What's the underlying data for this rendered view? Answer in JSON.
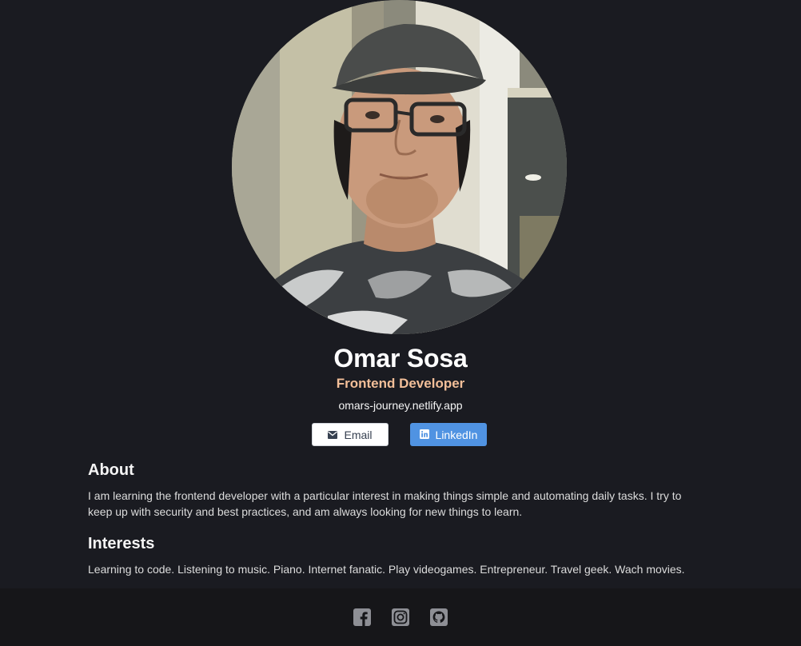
{
  "profile": {
    "name": "Omar Sosa",
    "role": "Frontend Developer",
    "website": "omars-journey.netlify.app"
  },
  "buttons": {
    "email_label": "Email",
    "email_icon": "envelope-icon",
    "linkedin_label": "LinkedIn",
    "linkedin_icon": "linkedin-icon"
  },
  "about": {
    "title": "About",
    "text": "I am learning the frontend developer with a particular interest in making things simple and automating daily tasks. I try to keep up with security and best practices, and am always looking for new things to learn."
  },
  "interests": {
    "title": "Interests",
    "text": "Learning to code. Listening to music. Piano. Internet fanatic. Play videogames. Entrepreneur. Travel geek. Wach movies."
  },
  "footer": {
    "icons": [
      "facebook-icon",
      "instagram-icon",
      "github-icon"
    ]
  },
  "colors": {
    "background": "#1a1b21",
    "footer_background": "#161619",
    "accent_role": "#f3bf99",
    "linkedin_blue": "#5093e2",
    "footer_icon": "#8e8f95"
  }
}
